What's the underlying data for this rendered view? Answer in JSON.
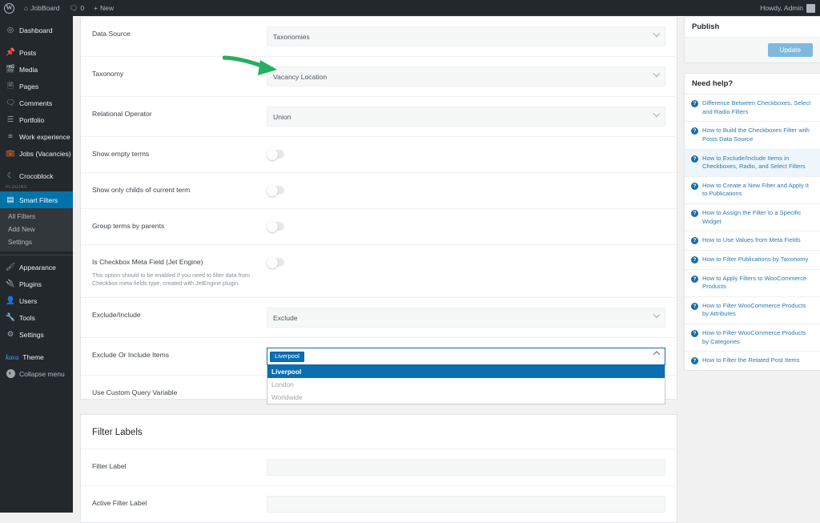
{
  "adminbar": {
    "logo_icon": "wordpress-logo-icon",
    "site_icon": "home-icon",
    "site_name": "JobBoard",
    "comments_icon": "comment-bubble-icon",
    "comments_count": "0",
    "new_icon": "plus-icon",
    "new_label": "New",
    "howdy": "Howdy, Admin",
    "avatar_icon": "user-avatar-icon"
  },
  "sidebar": {
    "items": [
      {
        "label": "Dashboard",
        "icon": "dashboard-icon",
        "glyph": "⌘"
      },
      {
        "label": "Posts",
        "icon": "pin-icon",
        "glyph": "✒"
      },
      {
        "label": "Media",
        "icon": "media-icon",
        "glyph": "♪"
      },
      {
        "label": "Pages",
        "icon": "page-icon",
        "glyph": "▤"
      },
      {
        "label": "Comments",
        "icon": "comment-bubble-icon",
        "glyph": "▭"
      },
      {
        "label": "Portfolio",
        "icon": "portfolio-icon",
        "glyph": "☰"
      },
      {
        "label": "Work experience",
        "icon": "list-icon",
        "glyph": "≡"
      },
      {
        "label": "Jobs (Vacancies)",
        "icon": "briefcase-icon",
        "glyph": "◧"
      },
      {
        "label": "Crocoblock",
        "icon": "crocoblock-icon",
        "glyph": "☾"
      }
    ],
    "group_label": "Plugins",
    "current": {
      "label": "Smart Filters",
      "icon": "smart-filters-icon",
      "glyph": "■"
    },
    "submenu": [
      "All Filters",
      "Add New",
      "Settings"
    ],
    "items2": [
      {
        "label": "Appearance",
        "icon": "brush-icon",
        "glyph": "✎"
      },
      {
        "label": "Plugins",
        "icon": "plug-icon",
        "glyph": "⚡"
      },
      {
        "label": "Users",
        "icon": "user-icon",
        "glyph": "☻"
      },
      {
        "label": "Tools",
        "icon": "wrench-icon",
        "glyph": "⚒"
      },
      {
        "label": "Settings",
        "icon": "gear-icon",
        "glyph": "⚙"
      }
    ],
    "theme": {
      "logo_text": "kava",
      "label": "Theme",
      "icon": "kava-theme-icon"
    },
    "collapse": {
      "label": "Collapse menu",
      "icon": "collapse-arrow-icon"
    }
  },
  "form": {
    "rows": [
      {
        "label": "Data Source",
        "value": "Taxonomies",
        "type": "select",
        "name": "data-source"
      },
      {
        "label": "Taxonomy",
        "value": "Vacancy Location",
        "type": "select",
        "name": "taxonomy"
      },
      {
        "label": "Relational Operator",
        "value": "Union",
        "type": "select",
        "name": "relational-operator"
      },
      {
        "label": "Show empty terms",
        "value": "",
        "type": "toggle",
        "name": "show-empty-terms"
      },
      {
        "label": "Show only childs of current term",
        "value": "",
        "type": "toggle",
        "name": "show-only-childs"
      },
      {
        "label": "Group terms by parents",
        "value": "",
        "type": "toggle",
        "name": "group-terms-by-parents"
      },
      {
        "label": "Is Checkbox Meta Field (Jet Engine)",
        "desc": "This option should to be enabled if you need to filter data from Checkbox meta fields type, created with JetEngine plugin.",
        "value": "",
        "type": "toggle",
        "name": "is-checkbox-meta-field"
      },
      {
        "label": "Exclude/Include",
        "value": "Exclude",
        "type": "select",
        "name": "exclude-include"
      }
    ],
    "multiselect": {
      "label": "Exclude Or Include Items",
      "name": "exclude-or-include-items",
      "selected_chips": [
        "Liverpool"
      ],
      "options": [
        {
          "label": "Liverpool",
          "selected": true
        },
        {
          "label": "London",
          "selected": false
        },
        {
          "label": "Worldwide",
          "selected": false
        }
      ]
    },
    "custom_query_row": {
      "label": "Use Custom Query Variable",
      "name": "use-custom-query-variable"
    }
  },
  "filter_labels": {
    "title": "Filter Labels",
    "rows": [
      {
        "label": "Filter Label",
        "value": "",
        "name": "filter-label"
      },
      {
        "label": "Active Filter Label",
        "value": "",
        "name": "active-filter-label"
      }
    ]
  },
  "publish": {
    "title": "Publish",
    "update_label": "Update"
  },
  "help": {
    "title": "Need help?",
    "links": [
      {
        "text": "Difference Between Checkboxes, Select and Radio Filters",
        "active": false
      },
      {
        "text": "How to Build the Checkboxes Filter with Posts Data Source",
        "active": false
      },
      {
        "text": "How to Exclude/Include Items in Checkboxes, Radio, and Select Filters",
        "active": true
      },
      {
        "text": "How to Create a New Filter and Apply It to Publications",
        "active": false
      },
      {
        "text": "How to Assign the Filter to a Specific Widget",
        "active": false
      },
      {
        "text": "How to Use Values from Meta Fields",
        "active": false
      },
      {
        "text": "How to Filter Publications by Taxonomy",
        "active": false
      },
      {
        "text": "How to Apply Filters to WooCommerce Products",
        "active": false
      },
      {
        "text": "How to Filter WooCommerce Products by Attributes",
        "active": false
      },
      {
        "text": "How to Filter WooCommerce Products by Categories",
        "active": false
      },
      {
        "text": "How to Filter the Related Post Items",
        "active": false
      }
    ],
    "icon": "question-mark-icon",
    "icon_glyph": "?"
  },
  "annotation": {
    "arrow_color": "#27ae60",
    "name": "green-pointer-arrow"
  },
  "colors": {
    "admin_bar": "#23282d",
    "menu_current": "#0073aa",
    "accent_blue": "#0c6eb0",
    "update_button": "#7fb9dd"
  }
}
